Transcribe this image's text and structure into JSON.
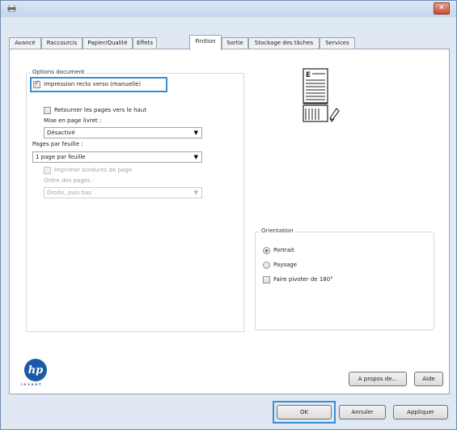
{
  "window": {
    "close_label": "✕"
  },
  "tabs": [
    {
      "label": "Avancé"
    },
    {
      "label": "Raccourcis"
    },
    {
      "label": "Papier/Qualité"
    },
    {
      "label": "Effets"
    },
    {
      "label": "Finition",
      "active": true
    },
    {
      "label": "Sortie"
    },
    {
      "label": "Stockage des tâches"
    },
    {
      "label": "Services"
    }
  ],
  "options_document": {
    "legend": "Options document",
    "duplex": {
      "label": "Impression recto verso (manuelle)",
      "checked": true
    },
    "flip_pages": {
      "label": "Retourner les pages vers le haut",
      "checked": false
    },
    "booklet": {
      "label": "Mise en page livret :",
      "value": "Désactivé"
    },
    "pages_per_sheet": {
      "label": "Pages par feuille :",
      "value": "1 page par feuille"
    },
    "print_borders": {
      "label": "Imprimer bordures de page",
      "checked": false,
      "disabled": true
    },
    "page_order": {
      "label": "Ordre des pages :",
      "value": "Droite, puis bas",
      "disabled": true
    }
  },
  "orientation": {
    "legend": "Orientation",
    "options": [
      {
        "label": "Portrait",
        "selected": true
      },
      {
        "label": "Paysage",
        "selected": false
      }
    ],
    "rotate": {
      "label": "Faire pivoter de 180°",
      "checked": false
    }
  },
  "logo": {
    "text": "invent"
  },
  "panel_buttons": {
    "about": "A propos de...",
    "help": "Aide"
  },
  "footer_buttons": {
    "ok": "OK",
    "cancel": "Annuler",
    "apply": "Appliquer"
  },
  "colors": {
    "highlight": "#3a8dd0",
    "hp_blue": "#1a5aa6"
  }
}
